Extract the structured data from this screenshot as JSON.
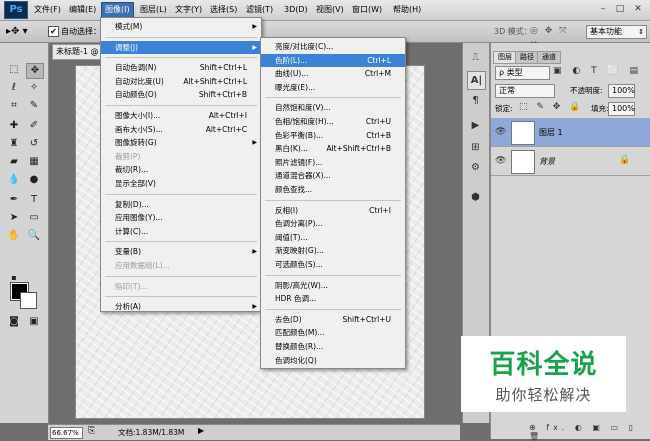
{
  "app": {
    "logo": "Ps"
  },
  "menubar": {
    "items": [
      "文件(F)",
      "编辑(E)",
      "图像(I)",
      "图层(L)",
      "文字(Y)",
      "选择(S)",
      "滤镜(T)",
      "3D(D)",
      "视图(V)",
      "窗口(W)",
      "帮助(H)"
    ],
    "active_index": 2
  },
  "window_controls": {
    "minimize": "–",
    "maximize": "□",
    "close": "✕"
  },
  "options_bar": {
    "auto_select_label": "自动选择：",
    "auto_select_checked": "✔",
    "mode_3d": "3D 模式：",
    "workspace": "基本功能"
  },
  "document": {
    "tab_title": "未标题-1 @"
  },
  "status_bar": {
    "zoom": "66.67%",
    "doc_info": "文档:1.83M/1.83M"
  },
  "image_menu": {
    "items": [
      {
        "label": "模式(M)",
        "shortcut": "",
        "submenu": true,
        "disabled": false
      },
      {
        "sep": true
      },
      {
        "label": "调整(J)",
        "shortcut": "",
        "submenu": true,
        "disabled": false,
        "highlight": true
      },
      {
        "sep": true
      },
      {
        "label": "自动色调(N)",
        "shortcut": "Shift+Ctrl+L",
        "disabled": false
      },
      {
        "label": "自动对比度(U)",
        "shortcut": "Alt+Shift+Ctrl+L",
        "disabled": false
      },
      {
        "label": "自动颜色(O)",
        "shortcut": "Shift+Ctrl+B",
        "disabled": false
      },
      {
        "sep": true
      },
      {
        "label": "图像大小(I)...",
        "shortcut": "Alt+Ctrl+I",
        "disabled": false
      },
      {
        "label": "画布大小(S)...",
        "shortcut": "Alt+Ctrl+C",
        "disabled": false
      },
      {
        "label": "图像旋转(G)",
        "shortcut": "",
        "submenu": true,
        "disabled": false
      },
      {
        "label": "裁剪(P)",
        "shortcut": "",
        "disabled": true
      },
      {
        "label": "裁切(R)...",
        "shortcut": "",
        "disabled": false
      },
      {
        "label": "显示全部(V)",
        "shortcut": "",
        "disabled": false
      },
      {
        "sep": true
      },
      {
        "label": "复制(D)...",
        "shortcut": "",
        "disabled": false
      },
      {
        "label": "应用图像(Y)...",
        "shortcut": "",
        "disabled": false
      },
      {
        "label": "计算(C)...",
        "shortcut": "",
        "disabled": false
      },
      {
        "sep": true
      },
      {
        "label": "变量(B)",
        "shortcut": "",
        "submenu": true,
        "disabled": false
      },
      {
        "label": "应用数据组(L)...",
        "shortcut": "",
        "disabled": true
      },
      {
        "sep": true
      },
      {
        "label": "陷印(T)...",
        "shortcut": "",
        "disabled": true
      },
      {
        "sep": true
      },
      {
        "label": "分析(A)",
        "shortcut": "",
        "submenu": true,
        "disabled": false
      }
    ]
  },
  "adjust_menu": {
    "items": [
      {
        "label": "亮度/对比度(C)...",
        "shortcut": ""
      },
      {
        "label": "色阶(L)...",
        "shortcut": "Ctrl+L",
        "highlight": true
      },
      {
        "label": "曲线(U)...",
        "shortcut": "Ctrl+M"
      },
      {
        "label": "曝光度(E)...",
        "shortcut": ""
      },
      {
        "sep": true
      },
      {
        "label": "自然饱和度(V)...",
        "shortcut": ""
      },
      {
        "label": "色相/饱和度(H)...",
        "shortcut": "Ctrl+U"
      },
      {
        "label": "色彩平衡(B)...",
        "shortcut": "Ctrl+B"
      },
      {
        "label": "黑白(K)...",
        "shortcut": "Alt+Shift+Ctrl+B"
      },
      {
        "label": "照片滤镜(F)...",
        "shortcut": ""
      },
      {
        "label": "通道混合器(X)...",
        "shortcut": ""
      },
      {
        "label": "颜色查找...",
        "shortcut": ""
      },
      {
        "sep": true
      },
      {
        "label": "反相(I)",
        "shortcut": "Ctrl+I"
      },
      {
        "label": "色调分离(P)...",
        "shortcut": ""
      },
      {
        "label": "阈值(T)...",
        "shortcut": ""
      },
      {
        "label": "渐变映射(G)...",
        "shortcut": ""
      },
      {
        "label": "可选颜色(S)...",
        "shortcut": ""
      },
      {
        "sep": true
      },
      {
        "label": "阴影/高光(W)...",
        "shortcut": ""
      },
      {
        "label": "HDR 色调...",
        "shortcut": ""
      },
      {
        "sep": true
      },
      {
        "label": "去色(D)",
        "shortcut": "Shift+Ctrl+U"
      },
      {
        "label": "匹配颜色(M)...",
        "shortcut": ""
      },
      {
        "label": "替换颜色(R)...",
        "shortcut": ""
      },
      {
        "label": "色调均化(Q)",
        "shortcut": ""
      }
    ]
  },
  "layers_panel": {
    "tabs": [
      "图层",
      "路径",
      "通道"
    ],
    "kind_filter": "ρ 类型",
    "blend_mode": "正常",
    "opacity_label": "不透明度:",
    "opacity_value": "100%",
    "lock_label": "锁定:",
    "fill_label": "填充:",
    "fill_value": "100%",
    "layers": [
      {
        "name": "图层 1",
        "selected": true
      },
      {
        "name": "背景",
        "selected": false,
        "locked": true
      }
    ],
    "bottom_icons": "⊕ fx. ◐ ▣ ▭ ▯ 🗑"
  },
  "watermark": {
    "title": "百科全说",
    "subtitle": "助你轻松解决"
  }
}
